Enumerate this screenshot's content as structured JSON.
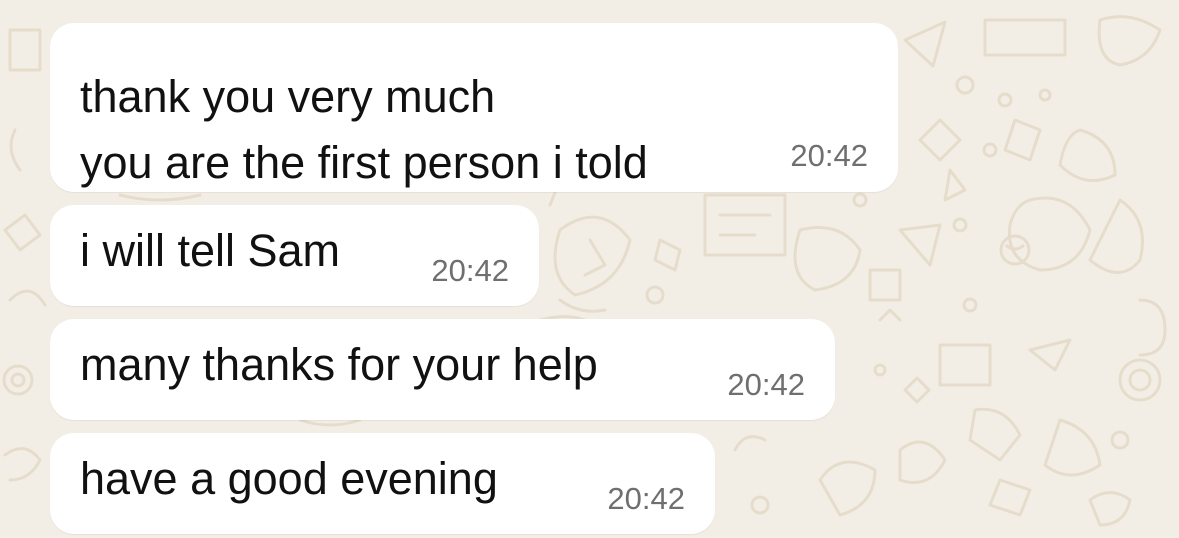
{
  "theme": {
    "background": "#f3eee5",
    "doodle_color": "#e6dccb",
    "bubble_color": "#ffffff",
    "text_color": "#111111",
    "time_color": "#6f6f6f"
  },
  "messages": [
    {
      "text": "thank you very much\nyou are the first person i told",
      "time": "20:42"
    },
    {
      "text": "i will tell Sam",
      "time": "20:42"
    },
    {
      "text": "many thanks for your help",
      "time": "20:42"
    },
    {
      "text": "have a good evening",
      "time": "20:42"
    }
  ]
}
